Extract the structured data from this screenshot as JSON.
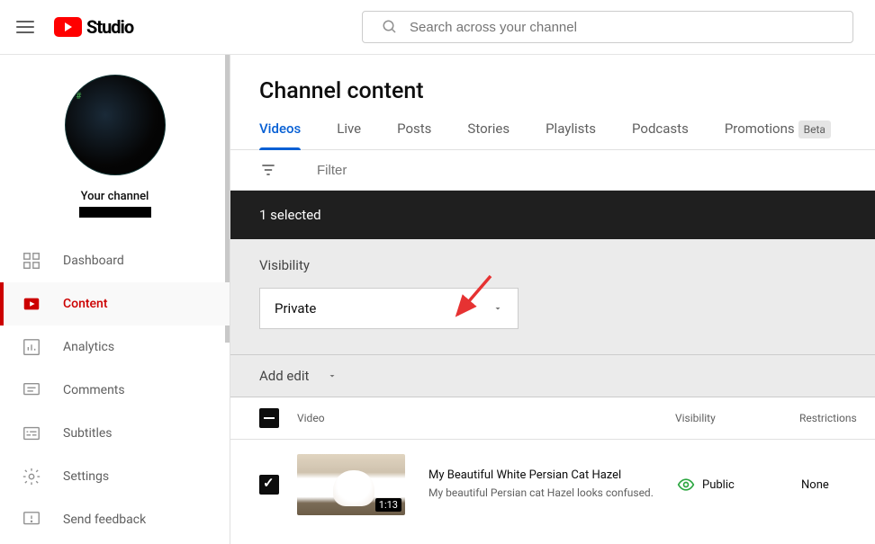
{
  "header": {
    "studio_label": "Studio",
    "search_placeholder": "Search across your channel"
  },
  "sidebar": {
    "channel_label": "Your channel",
    "items": [
      {
        "label": "Dashboard"
      },
      {
        "label": "Content"
      },
      {
        "label": "Analytics"
      },
      {
        "label": "Comments"
      },
      {
        "label": "Subtitles"
      },
      {
        "label": "Settings"
      },
      {
        "label": "Send feedback"
      }
    ]
  },
  "main": {
    "title": "Channel content",
    "tabs": [
      {
        "label": "Videos"
      },
      {
        "label": "Live"
      },
      {
        "label": "Posts"
      },
      {
        "label": "Stories"
      },
      {
        "label": "Playlists"
      },
      {
        "label": "Podcasts"
      },
      {
        "label": "Promotions"
      }
    ],
    "beta": "Beta",
    "filter_placeholder": "Filter",
    "selected_text": "1 selected",
    "visibility_label": "Visibility",
    "visibility_value": "Private",
    "add_edit_label": "Add edit",
    "table": {
      "video_header": "Video",
      "visibility_header": "Visibility",
      "restrictions_header": "Restrictions"
    },
    "rows": [
      {
        "duration": "1:13",
        "title": "My Beautiful White Persian Cat Hazel",
        "desc": "My beautiful Persian cat Hazel looks confused.",
        "visibility": "Public",
        "restrictions": "None"
      }
    ]
  }
}
